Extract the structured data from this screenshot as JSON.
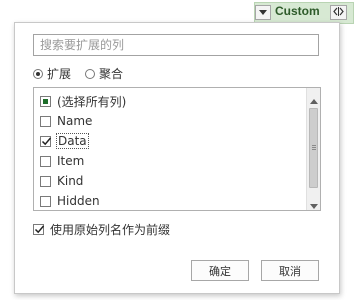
{
  "column_header": {
    "title": "Custom",
    "dropdown_icon": "chevron-down-icon",
    "expand_icon": "expand-columns-icon",
    "header_color": "#d7e9d3"
  },
  "dialog": {
    "search_placeholder": "搜索要扩展的列",
    "mode_options": [
      {
        "label": "扩展",
        "selected": true
      },
      {
        "label": "聚合",
        "selected": false
      }
    ],
    "columns": [
      {
        "label": "(选择所有列)",
        "state": "partial"
      },
      {
        "label": "Name",
        "state": "unchecked"
      },
      {
        "label": "Data",
        "state": "checked"
      },
      {
        "label": "Item",
        "state": "unchecked"
      },
      {
        "label": "Kind",
        "state": "unchecked"
      },
      {
        "label": "Hidden",
        "state": "unchecked"
      }
    ],
    "use_prefix": {
      "label": "使用原始列名作为前缀",
      "checked": true
    },
    "ok_label": "确定",
    "cancel_label": "取消"
  }
}
